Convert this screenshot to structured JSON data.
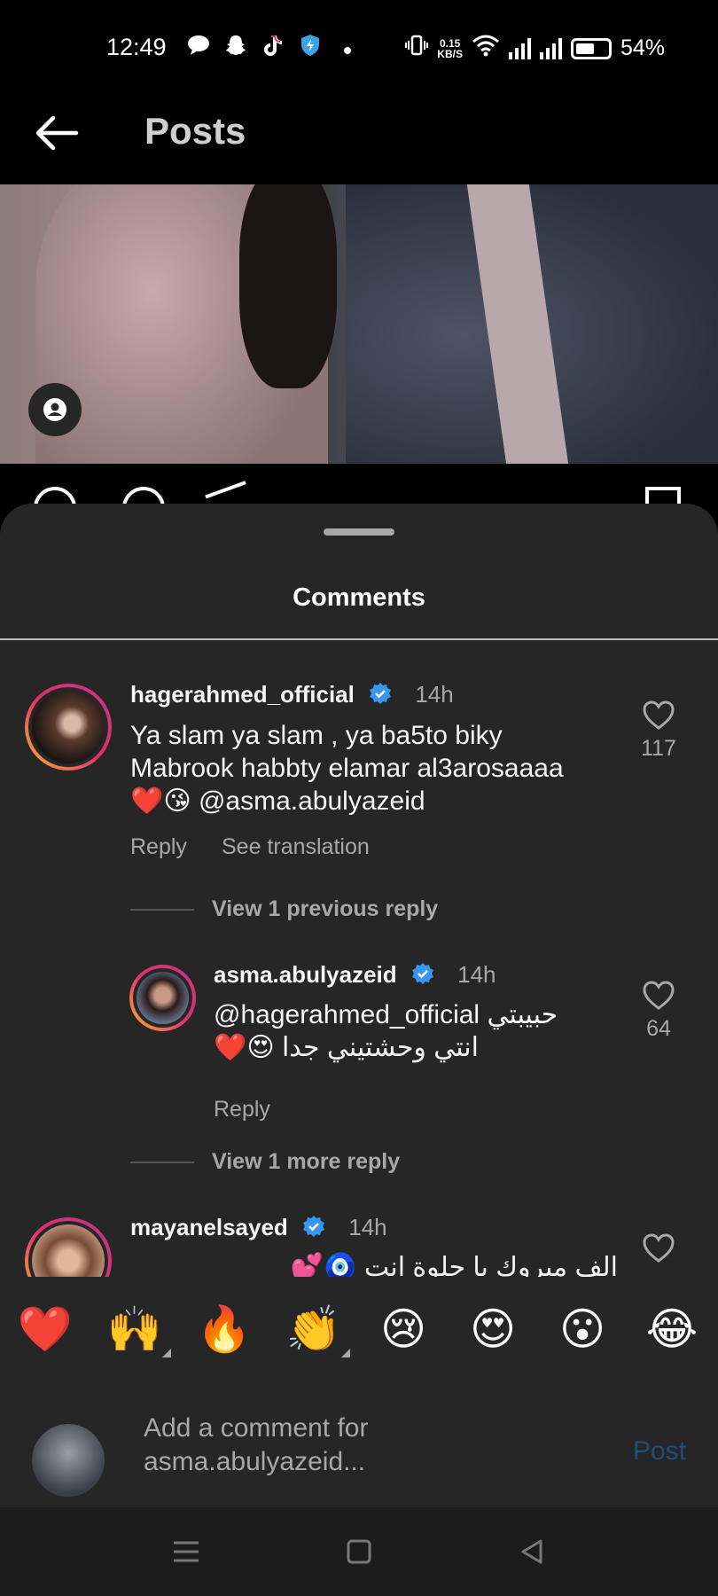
{
  "status_bar": {
    "time": "12:49",
    "net_speed_value": "0.15",
    "net_speed_unit": "KB/S",
    "battery": "54%",
    "icons": [
      "message-icon",
      "snapchat-icon",
      "tiktok-icon",
      "shield-icon",
      "dot-icon",
      "vibrate-icon",
      "wifi-icon",
      "signal-icon",
      "signal-icon",
      "battery-icon"
    ]
  },
  "header": {
    "title": "Posts",
    "back_icon": "arrow-left-icon"
  },
  "sheet": {
    "title": "Comments"
  },
  "comments": [
    {
      "username": "hagerahmed_official",
      "verified": true,
      "time": "14h",
      "text_line1": "Ya slam ya slam , ya ba5to biky",
      "text_line2": "Mabrook habbty elamar al3arosaaaa",
      "text_line3": "❤️😘 @asma.abulyazeid",
      "likes": "117",
      "reply_label": "Reply",
      "translate_label": "See translation"
    },
    {
      "view_replies": "View 1 previous reply"
    },
    {
      "username": "asma.abulyazeid",
      "verified": true,
      "time": "14h",
      "text_line1": "@hagerahmed_official حبيبتي",
      "text_line2": "انتي وحشتيني جدا 😍❤️",
      "likes": "64",
      "reply_label": "Reply"
    },
    {
      "view_replies": "View 1 more reply"
    },
    {
      "username": "mayanelsayed",
      "verified": true,
      "time": "14h",
      "text_line1": "الف مبروك يا حلوة انتِ 🧿💕"
    }
  ],
  "emoji_bar": [
    "❤️",
    "🙌",
    "🔥",
    "👏",
    "😢",
    "😍",
    "😮",
    "😂"
  ],
  "composer": {
    "placeholder_line1": "Add a comment for",
    "placeholder_line2": "asma.abulyazeid...",
    "post_label": "Post"
  },
  "colors": {
    "sheet_bg": "#262626",
    "verified_blue": "#3897f0",
    "secondary_text": "#a8a8a8",
    "post_disabled": "#1f4f7a"
  }
}
